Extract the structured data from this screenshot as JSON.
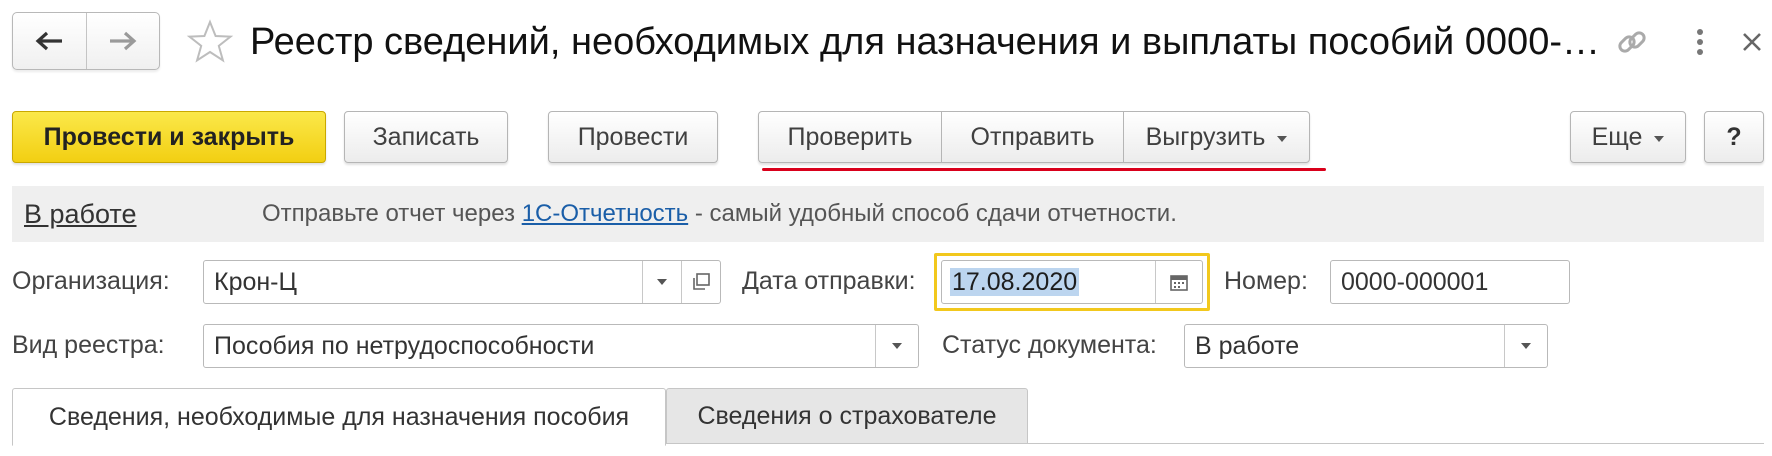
{
  "window": {
    "title": "Реестр сведений, необходимых для назначения и выплаты пособий 0000-…"
  },
  "toolbar": {
    "post_and_close": "Провести и закрыть",
    "save": "Записать",
    "post": "Провести",
    "check": "Проверить",
    "send": "Отправить",
    "export": "Выгрузить",
    "more": "Еще",
    "help": "?"
  },
  "status_bar": {
    "status_link": "В работе",
    "message_prefix": "Отправьте отчет через ",
    "message_link": "1С-Отчетность",
    "message_suffix": " - самый удобный способ сдачи отчетности."
  },
  "form": {
    "organization": {
      "label": "Организация:",
      "value": "Крон-Ц"
    },
    "send_date": {
      "label": "Дата отправки:",
      "value": "17.08.2020"
    },
    "number": {
      "label": "Номер:",
      "value": "0000-000001"
    },
    "registry_type": {
      "label": "Вид реестра:",
      "value": "Пособия по нетрудоспособности"
    },
    "doc_status": {
      "label": "Статус документа:",
      "value": "В работе"
    }
  },
  "tabs": [
    {
      "label": "Сведения, необходимые для назначения пособия",
      "active": true
    },
    {
      "label": "Сведения о страхователе",
      "active": false
    }
  ],
  "colors": {
    "primary_button": "#f5d51e",
    "highlight_border": "#f2c81d",
    "link": "#1a5ea8",
    "underline_mark": "#d9001b"
  }
}
